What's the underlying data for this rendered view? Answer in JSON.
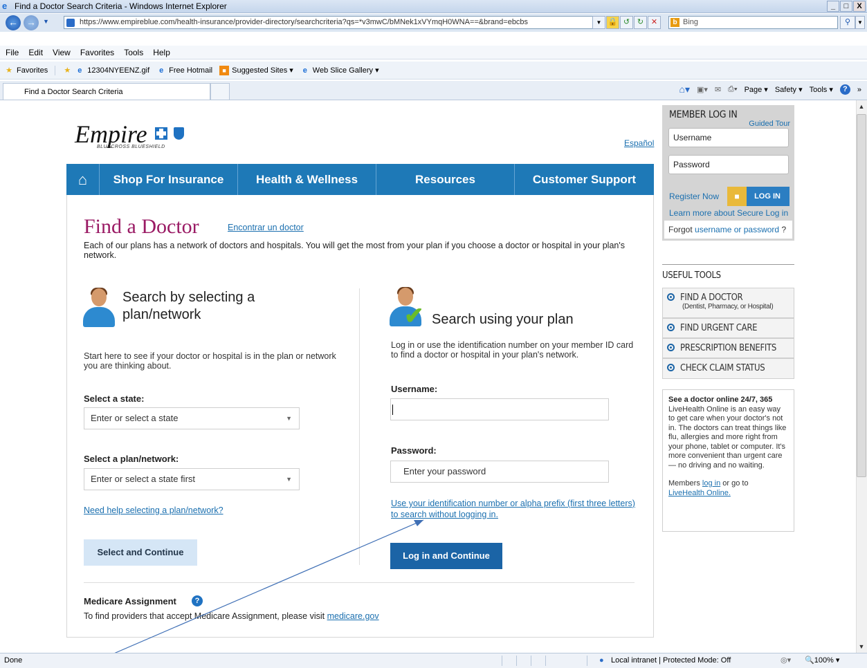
{
  "window": {
    "title": "Find a Doctor Search Criteria - Windows Internet Explorer",
    "minimize": "_",
    "maximize": "□",
    "close": "X"
  },
  "address": {
    "url": "https://www.empireblue.com/health-insurance/provider-directory/searchcriteria?qs=*v3mwC/bMNek1xVYmqH0WNA==&brand=ebcbs",
    "search_engine": "Bing"
  },
  "menu": [
    "File",
    "Edit",
    "View",
    "Favorites",
    "Tools",
    "Help"
  ],
  "favorites_bar": {
    "favorites": "Favorites",
    "items": [
      "12304NYEENZ.gif",
      "Free Hotmail",
      "Suggested Sites ▾",
      "Web Slice Gallery ▾"
    ]
  },
  "tab": {
    "title": "Find a Doctor Search Criteria"
  },
  "command_bar": [
    "Page ▾",
    "Safety ▾",
    "Tools ▾"
  ],
  "site": {
    "logo": "Empire",
    "logo_sub": "BLUECROSS BLUESHIELD",
    "espanol": "Español",
    "nav": [
      "Shop For Insurance",
      "Health & Wellness",
      "Resources",
      "Customer Support"
    ]
  },
  "main": {
    "title": "Find a Doctor",
    "title_link": "Encontrar un doctor",
    "intro": "Each of our plans has a network of doctors and hospitals. You will get the most from your plan if you choose a doctor or hospital in your plan's network.",
    "left": {
      "heading": "Search by selecting a plan/network",
      "desc": "Start here to see if your doctor or hospital is in the plan or network you are thinking about.",
      "state_label": "Select a state:",
      "state_placeholder": "Enter or select a state",
      "plan_label": "Select a plan/network:",
      "plan_placeholder": "Enter or select a state first",
      "help_link": "Need help selecting a plan/network?",
      "button": "Select and Continue"
    },
    "right": {
      "heading": "Search using your plan",
      "desc": "Log in or use the identification number on your member ID card to find a doctor or hospital in your plan's network.",
      "username_label": "Username:",
      "password_label": "Password:",
      "password_placeholder": "Enter your password",
      "id_link": "Use your identification number or alpha prefix (first three letters) to search without logging in.",
      "button": "Log in and Continue"
    },
    "medicare": {
      "title": "Medicare Assignment",
      "text": "To find providers that accept Medicare Assignment, please visit",
      "link": "medicare.gov"
    }
  },
  "sidebar": {
    "login": {
      "title": "MEMBER LOG IN",
      "guided_tour": "Guided Tour",
      "username_placeholder": "Username",
      "password_placeholder": "Password",
      "register": "Register Now",
      "login_button": "LOG IN",
      "secure": "Learn more about Secure Log in",
      "forgot_prefix": "Forgot",
      "forgot_link": "username or password",
      "forgot_suffix": "?"
    },
    "tools_title": "USEFUL TOOLS",
    "tools": [
      {
        "label": "FIND A DOCTOR",
        "sub": "(Dentist, Pharmacy, or Hospital)"
      },
      {
        "label": "FIND URGENT CARE"
      },
      {
        "label": "PRESCRIPTION BENEFITS"
      },
      {
        "label": "CHECK CLAIM STATUS"
      }
    ],
    "online": {
      "title": "See a doctor online 24/7, 365",
      "body": "LiveHealth Online is an easy way to get care when your doctor's not in. The doctors can treat things like flu, allergies and more right from your phone, tablet or computer. It's more convenient than urgent care — no driving and no waiting.",
      "members_prefix": "Members",
      "login_link": "log in",
      "members_mid": "or go to",
      "lho_link": "LiveHealth Online."
    }
  },
  "status": {
    "left": "Done",
    "zone": "Local intranet | Protected Mode: Off",
    "zoom": "100%"
  }
}
